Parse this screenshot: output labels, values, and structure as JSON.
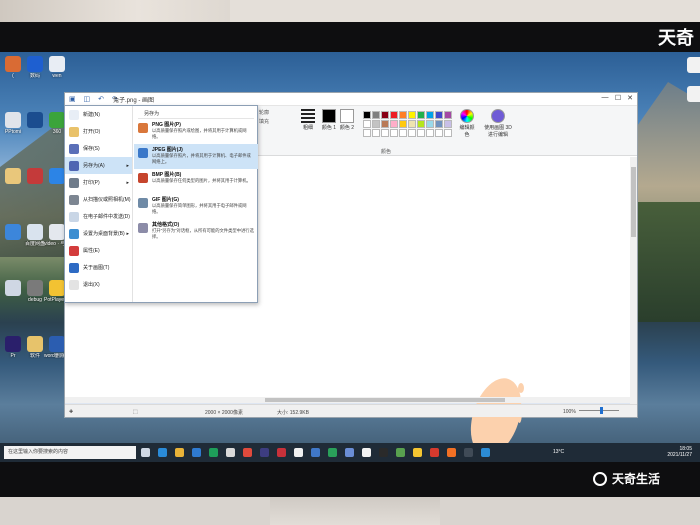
{
  "watermark": {
    "top": "天奇",
    "bottom": "天奇生活"
  },
  "desktop_icons": [
    {
      "label": "(",
      "color": "#d96b34"
    },
    {
      "label": "PPtomi",
      "color": "#e1e4ea"
    },
    {
      "label": "",
      "color": "#e9c77b"
    },
    {
      "label": "",
      "color": "#3c86db"
    },
    {
      "label": "",
      "color": "#cfd7e4"
    },
    {
      "label": "Pr",
      "color": "#2a1f6b"
    },
    {
      "label": "数码",
      "color": "#1e5fd0"
    },
    {
      "label": "",
      "color": "#1b4d8f"
    },
    {
      "label": "",
      "color": "#c43a3a"
    },
    {
      "label": "百度网盘",
      "color": "#d9e3ee"
    },
    {
      "label": "debug",
      "color": "#7a7a7a"
    },
    {
      "label": "软件",
      "color": "#e7c36b"
    },
    {
      "label": "wen",
      "color": "#e8edf4"
    },
    {
      "label": "360",
      "color": "#3ba43b"
    },
    {
      "label": "",
      "color": "#2c84e6"
    },
    {
      "label": "video · 与线方式",
      "color": "#e4e8ee"
    },
    {
      "label": "PotPlayer 64 bit",
      "color": "#f2c232"
    },
    {
      "label": "word删除分页符.docx",
      "color": "#2b5db0"
    }
  ],
  "right_icons": [
    {
      "label": ""
    },
    {
      "label": ""
    }
  ],
  "paint": {
    "file_tab": "文件",
    "title": "兔子.png - 画图",
    "window_controls": {
      "min": "—",
      "max": "☐",
      "close": "✕"
    },
    "ribbon": {
      "brushes_top": "轮廓",
      "brushes_bottom": "填充",
      "size_label": "粗细",
      "color1": "颜色 1",
      "color2": "颜色 2",
      "colors_group": "颜色",
      "edit_colors": "编辑颜色",
      "paint3d": "使用画图 3D 进行编辑"
    },
    "palette": [
      "#000000",
      "#7f7f7f",
      "#880015",
      "#ed1c24",
      "#ff7f27",
      "#fff200",
      "#22b14c",
      "#00a2e8",
      "#3f48cc",
      "#a349a4",
      "#ffffff",
      "#c3c3c3",
      "#b97a57",
      "#ffaec9",
      "#ffc90e",
      "#efe4b0",
      "#b5e61d",
      "#99d9ea",
      "#7092be",
      "#c8bfe7",
      "#ffffff",
      "#ffffff",
      "#ffffff",
      "#ffffff",
      "#ffffff",
      "#ffffff",
      "#ffffff",
      "#ffffff",
      "#ffffff",
      "#ffffff"
    ],
    "status": {
      "dimensions": "2000 × 2000像素",
      "size": "大小: 152.9KB",
      "zoom": "100%"
    }
  },
  "file_menu": {
    "items": [
      {
        "label": "新建(N)",
        "color": "#e8eef6"
      },
      {
        "label": "打开(O)",
        "color": "#e9c26a"
      },
      {
        "label": "保存(S)",
        "color": "#5a6fb8"
      },
      {
        "label": "另存为(A)",
        "color": "#4f66b3",
        "arrow": "▸"
      },
      {
        "label": "打印(P)",
        "color": "#6f7c8b",
        "arrow": "▸"
      },
      {
        "label": "从扫描仪或照相机(M)",
        "color": "#7d8692"
      },
      {
        "label": "在电子邮件中发送(D)",
        "color": "#c9d6e6"
      },
      {
        "label": "设置为桌面背景(B)",
        "color": "#3d8ed1",
        "arrow": "▸"
      },
      {
        "label": "属性(E)",
        "color": "#d33c3c"
      },
      {
        "label": "关于画图(T)",
        "color": "#2e6bc4"
      },
      {
        "label": "退出(X)",
        "color": "#e3e3e3"
      }
    ],
    "save_as_header": "另存为",
    "save_as": [
      {
        "title": "PNG 图片(P)",
        "desc": "以高质量保存照片或绘图，并将其用于计算机或网络。",
        "color": "#d9773b"
      },
      {
        "title": "JPEG 图片(J)",
        "desc": "以高质量保存照片，并将其用于计算机、电子邮件或网络上。",
        "color": "#3b78c9"
      },
      {
        "title": "BMP 图片(B)",
        "desc": "以高质量保存任何类型的图片，并将其用于计算机。",
        "color": "#c6452d"
      },
      {
        "title": "GIF 图片(G)",
        "desc": "以高质量保存简单图形，并将其用于电子邮件或网络。",
        "color": "#6f8aa6"
      },
      {
        "title": "其他格式(O)",
        "desc": "打开\"另存为\"对话框，从所有可能的文件类型中进行选择。",
        "color": "#8c8ca8"
      }
    ]
  },
  "taskbar": {
    "search_placeholder": "在这里输入你要搜索的内容",
    "temperature": "13°C",
    "time": "18:05",
    "date": "2021/11/27",
    "icon_colors": [
      "#cfd8e4",
      "#2a8bd8",
      "#e9b338",
      "#2f7bd1",
      "#1e9e5a",
      "#d9d9d9",
      "#e04a3c",
      "#3d3d80",
      "#c8313a",
      "#f0f0f0",
      "#4078c8",
      "#2aa05a",
      "#6b8ed6",
      "#f2f2f2",
      "#2a2a2a",
      "#59a14f",
      "#f5c531",
      "#d63a2e",
      "#f27024",
      "#404b57",
      "#2c8cd5"
    ]
  }
}
